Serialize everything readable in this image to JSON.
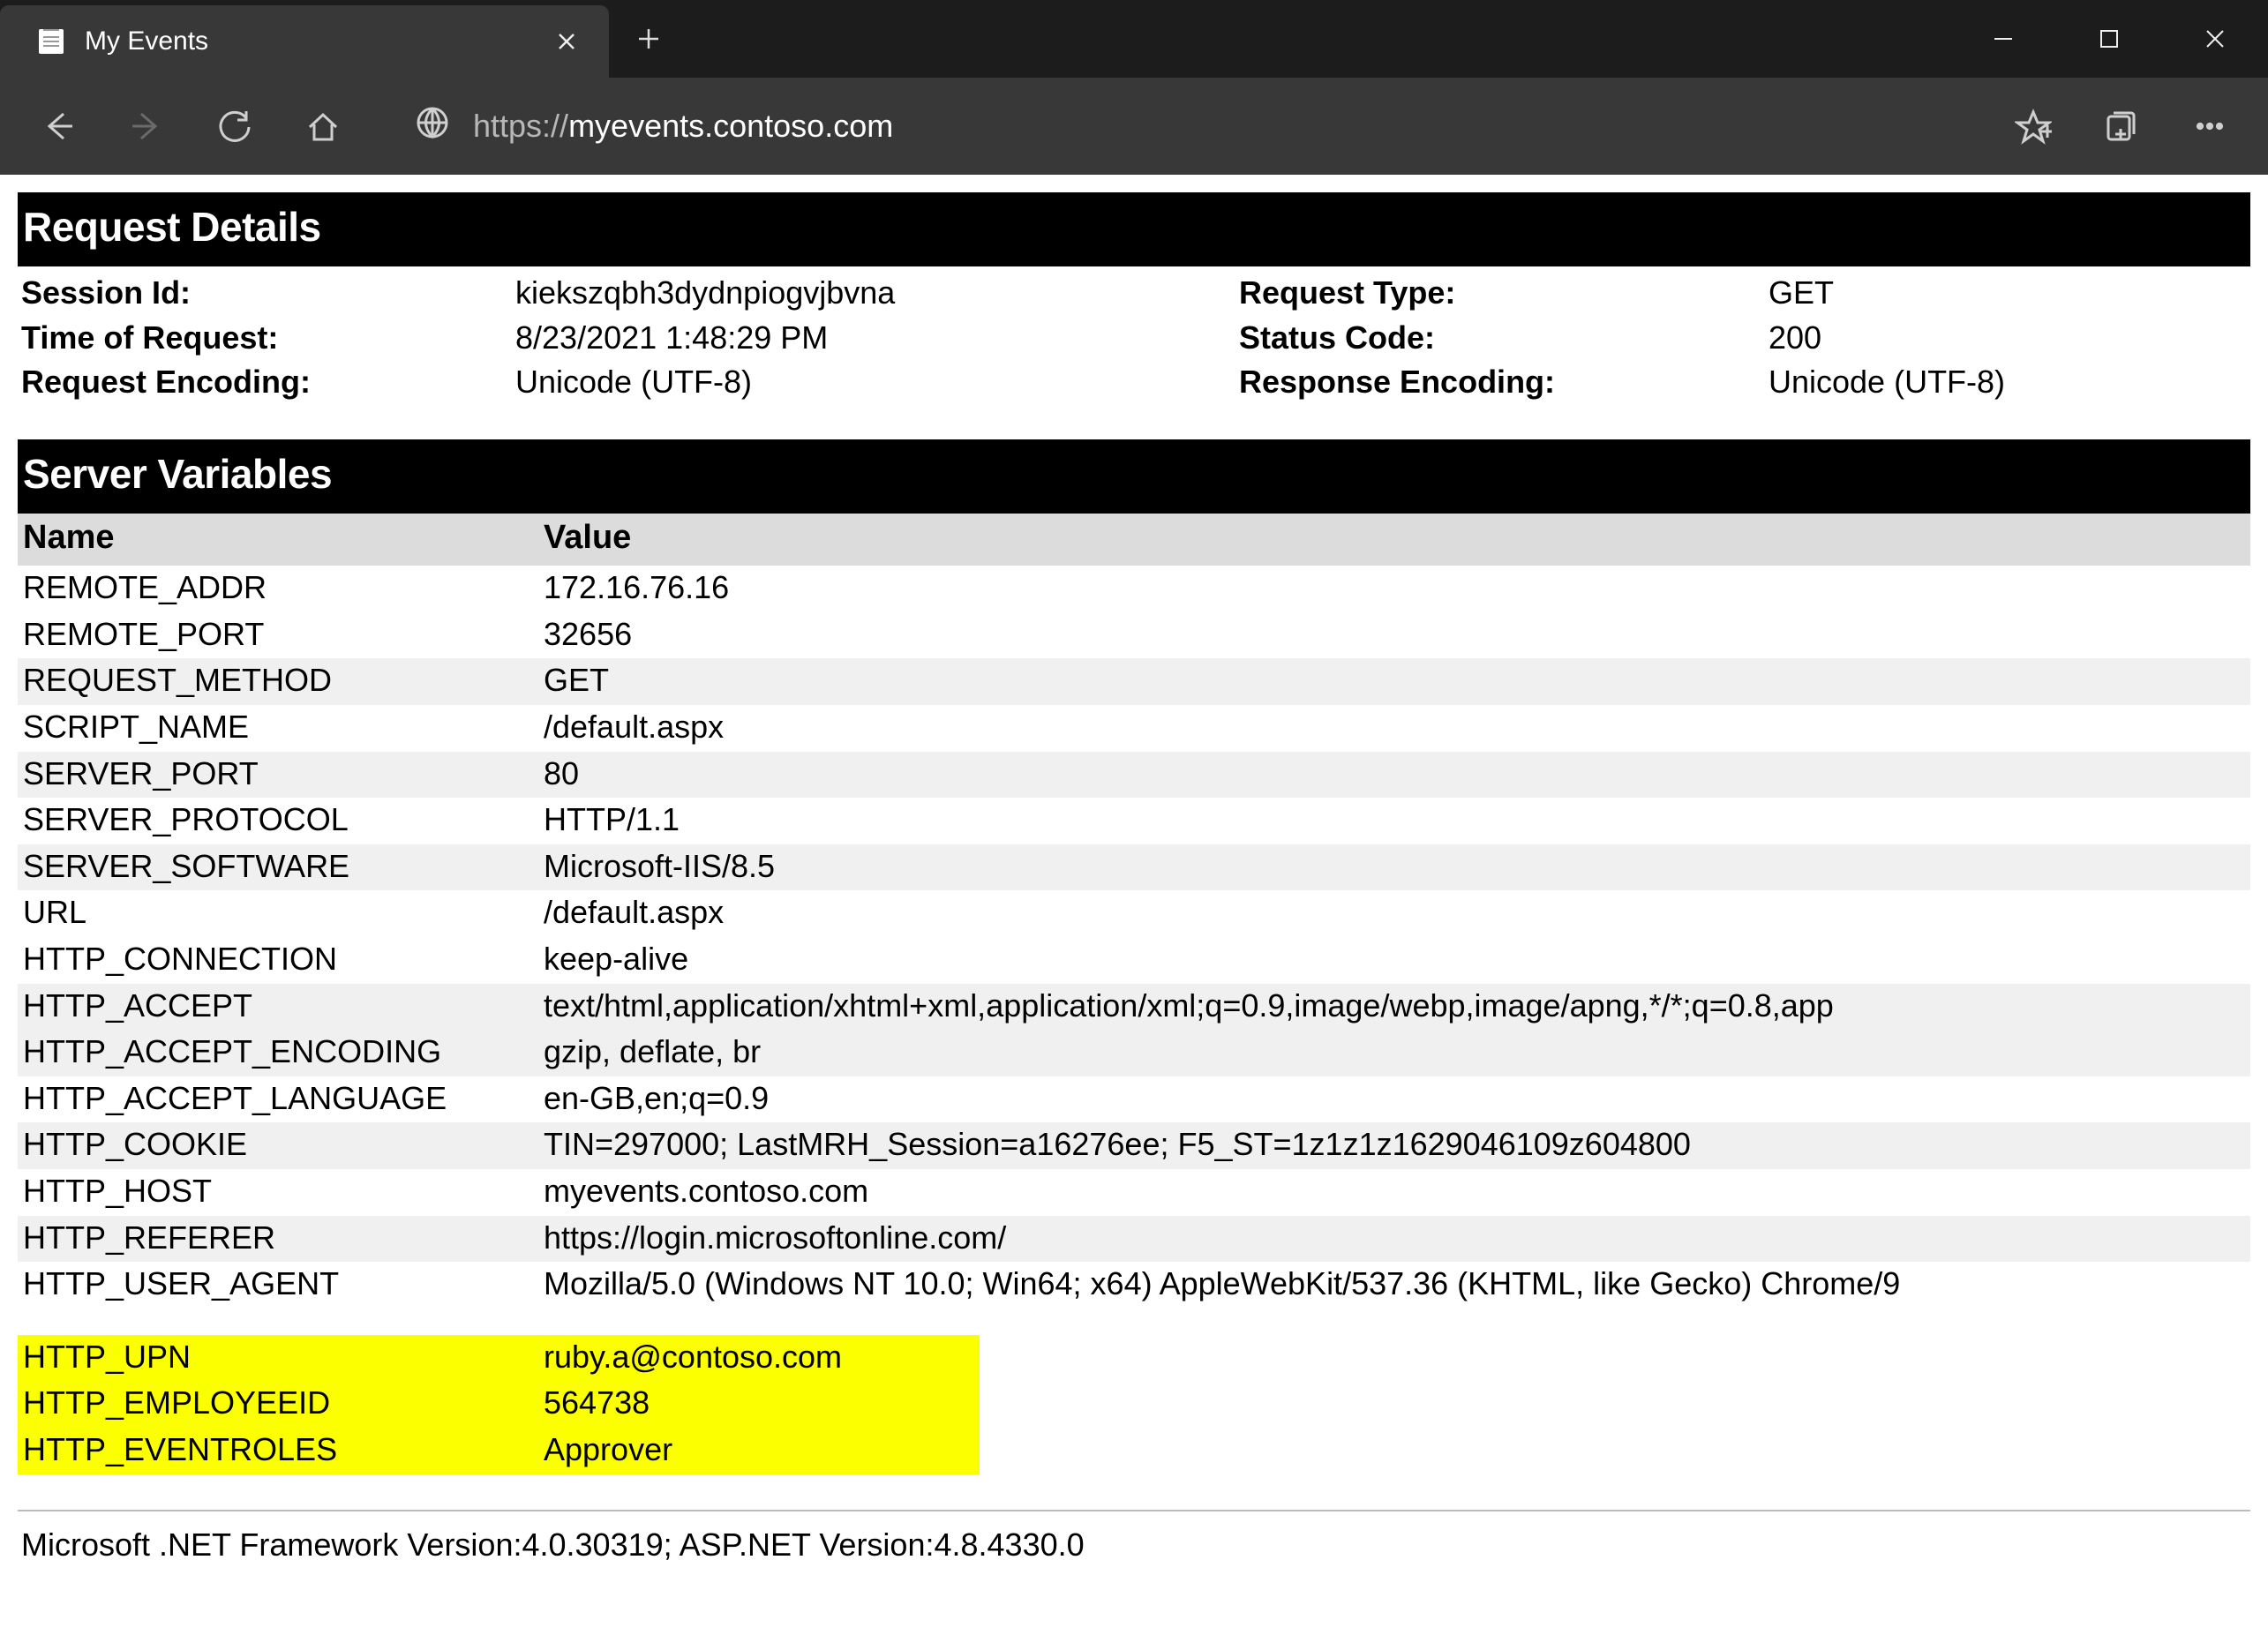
{
  "window": {
    "tab_title": "My Events"
  },
  "address": {
    "scheme": "https://",
    "host": "myevents.contoso.com"
  },
  "sections": {
    "request_details": "Request Details",
    "server_variables": "Server Variables"
  },
  "request": {
    "labels": {
      "session_id": "Session Id:",
      "request_type": "Request Type:",
      "time": "Time of Request:",
      "status_code": "Status Code:",
      "req_enc": "Request Encoding:",
      "resp_enc": "Response Encoding:"
    },
    "session_id": "kiekszqbh3dydnpiogvjbvna",
    "request_type": "GET",
    "time": "8/23/2021 1:48:29 PM",
    "status_code": "200",
    "req_enc": "Unicode (UTF-8)",
    "resp_enc": "Unicode (UTF-8)"
  },
  "vars_header": {
    "name": "Name",
    "value": "Value"
  },
  "vars": [
    {
      "name": "REMOTE_ADDR",
      "value": "172.16.76.16"
    },
    {
      "name": "REMOTE_PORT",
      "value": "32656"
    },
    {
      "name": "REQUEST_METHOD",
      "value": "GET"
    },
    {
      "name": "SCRIPT_NAME",
      "value": "/default.aspx"
    },
    {
      "name": "SERVER_PORT",
      "value": "80"
    },
    {
      "name": "SERVER_PROTOCOL",
      "value": "HTTP/1.1"
    },
    {
      "name": "SERVER_SOFTWARE",
      "value": "Microsoft-IIS/8.5"
    },
    {
      "name": "URL",
      "value": "/default.aspx"
    },
    {
      "name": "HTTP_CONNECTION",
      "value": "keep-alive"
    },
    {
      "name": "HTTP_ACCEPT",
      "value": "text/html,application/xhtml+xml,application/xml;q=0.9,image/webp,image/apng,*/*;q=0.8,app"
    },
    {
      "name": "HTTP_ACCEPT_ENCODING",
      "value": "gzip, deflate, br"
    },
    {
      "name": "HTTP_ACCEPT_LANGUAGE",
      "value": "en-GB,en;q=0.9"
    },
    {
      "name": "HTTP_COOKIE",
      "value": "TIN=297000; LastMRH_Session=a16276ee; F5_ST=1z1z1z1629046109z604800"
    },
    {
      "name": "HTTP_HOST",
      "value": "myevents.contoso.com"
    },
    {
      "name": "HTTP_REFERER",
      "value": "https://login.microsoftonline.com/"
    },
    {
      "name": "HTTP_USER_AGENT",
      "value": "Mozilla/5.0 (Windows NT 10.0; Win64; x64) AppleWebKit/537.36 (KHTML, like Gecko) Chrome/9"
    }
  ],
  "highlight_vars": [
    {
      "name": "HTTP_UPN",
      "value": "ruby.a@contoso.com"
    },
    {
      "name": "HTTP_EMPLOYEEID",
      "value": "564738"
    },
    {
      "name": "HTTP_EVENTROLES",
      "value": "Approver"
    }
  ],
  "footer": "Microsoft .NET Framework Version:4.0.30319; ASP.NET Version:4.8.4330.0"
}
